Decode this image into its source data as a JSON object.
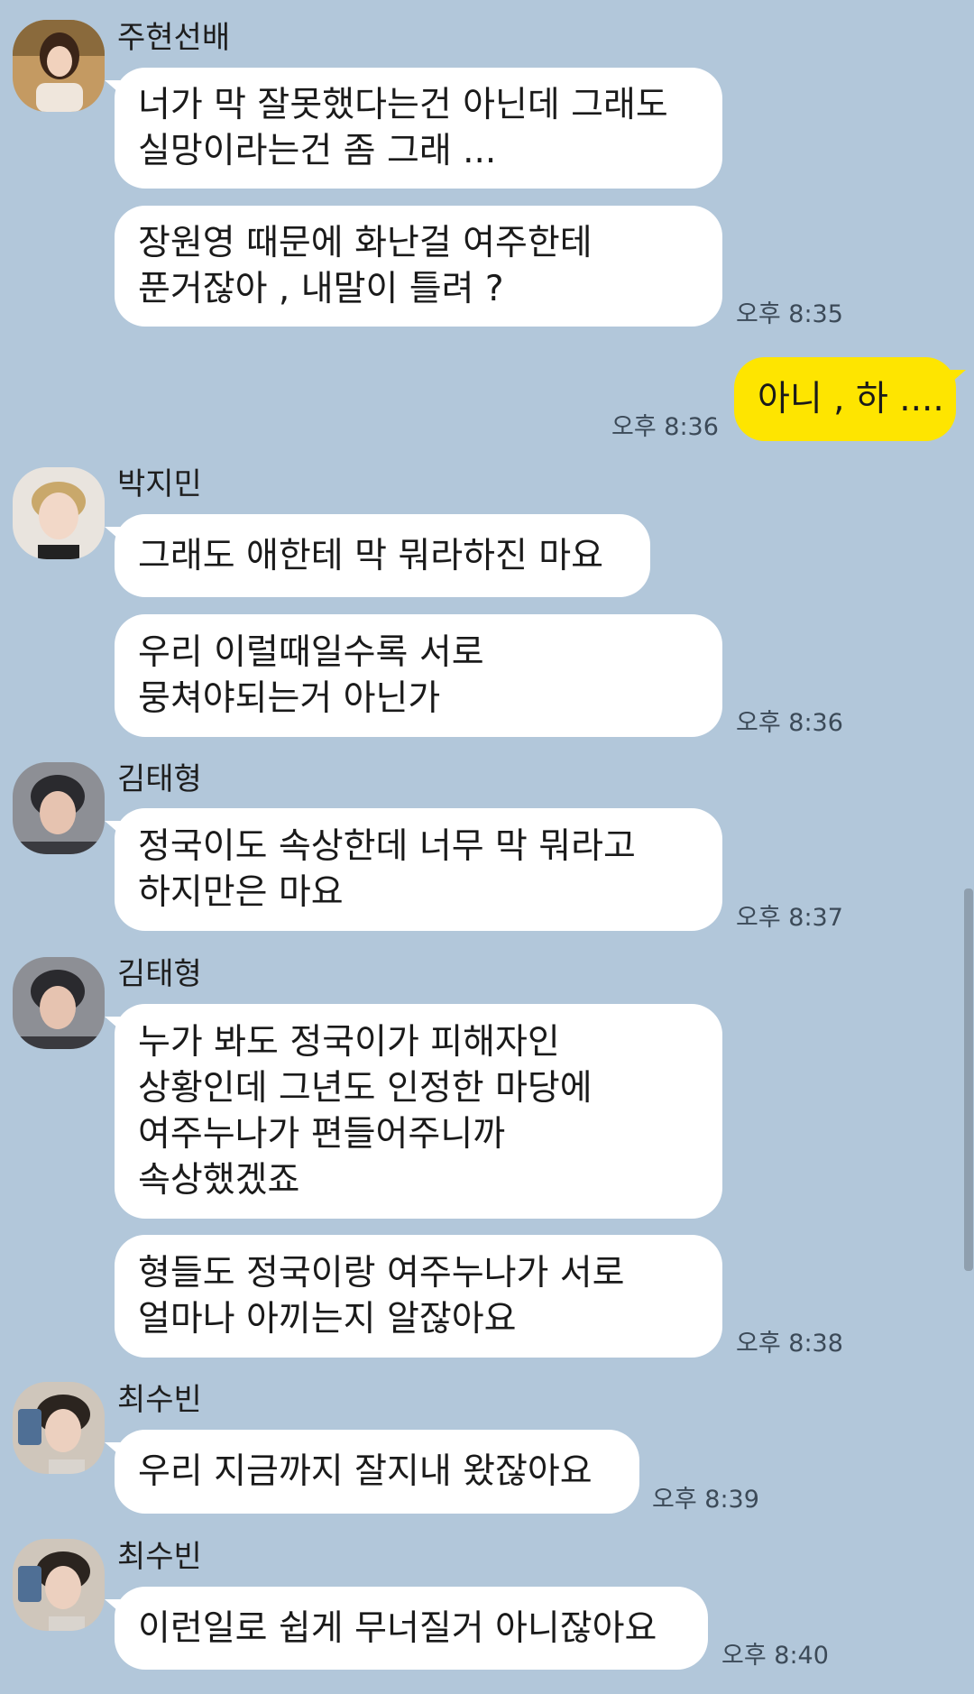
{
  "messages": [
    {
      "sender": "주현선배",
      "lines": [
        "너가 막 잘못했다는건 아닌데 그래도\n실망이라는건 좀 그래 ...",
        "장원영 때문에 화난걸 여주한테\n푼거잖아 , 내말이 틀려 ?"
      ],
      "time": "오후 8:35"
    },
    {
      "sender": "me",
      "lines": [
        "아니 , 하 ...."
      ],
      "time": "오후 8:36"
    },
    {
      "sender": "박지민",
      "lines": [
        "그래도 애한테 막 뭐라하진 마요",
        "우리 이럴때일수록 서로\n뭉쳐야되는거 아닌가"
      ],
      "time": "오후 8:36"
    },
    {
      "sender": "김태형",
      "lines": [
        "정국이도 속상한데 너무 막 뭐라고\n하지만은 마요"
      ],
      "time": "오후 8:37"
    },
    {
      "sender": "김태형",
      "lines": [
        "누가 봐도 정국이가 피해자인\n상황인데 그년도 인정한 마당에\n여주누나가 편들어주니까\n속상했겠죠",
        "형들도 정국이랑 여주누나가 서로\n얼마나 아끼는지 알잖아요"
      ],
      "time": "오후 8:38"
    },
    {
      "sender": "최수빈",
      "lines": [
        "우리 지금까지 잘지내 왔잖아요"
      ],
      "time": "오후 8:39"
    },
    {
      "sender": "최수빈",
      "lines": [
        "이런일로 쉽게 무너질거 아니잖아요"
      ],
      "time": "오후 8:40"
    }
  ],
  "colors": {
    "background": "#b2c7da",
    "bubble_other": "#ffffff",
    "bubble_mine": "#fee500"
  },
  "icons": {
    "avatar_1": "profile-photo-juhyun",
    "avatar_2": "profile-photo-jimin",
    "avatar_3": "profile-photo-taehyung",
    "avatar_4": "profile-photo-soobin"
  }
}
